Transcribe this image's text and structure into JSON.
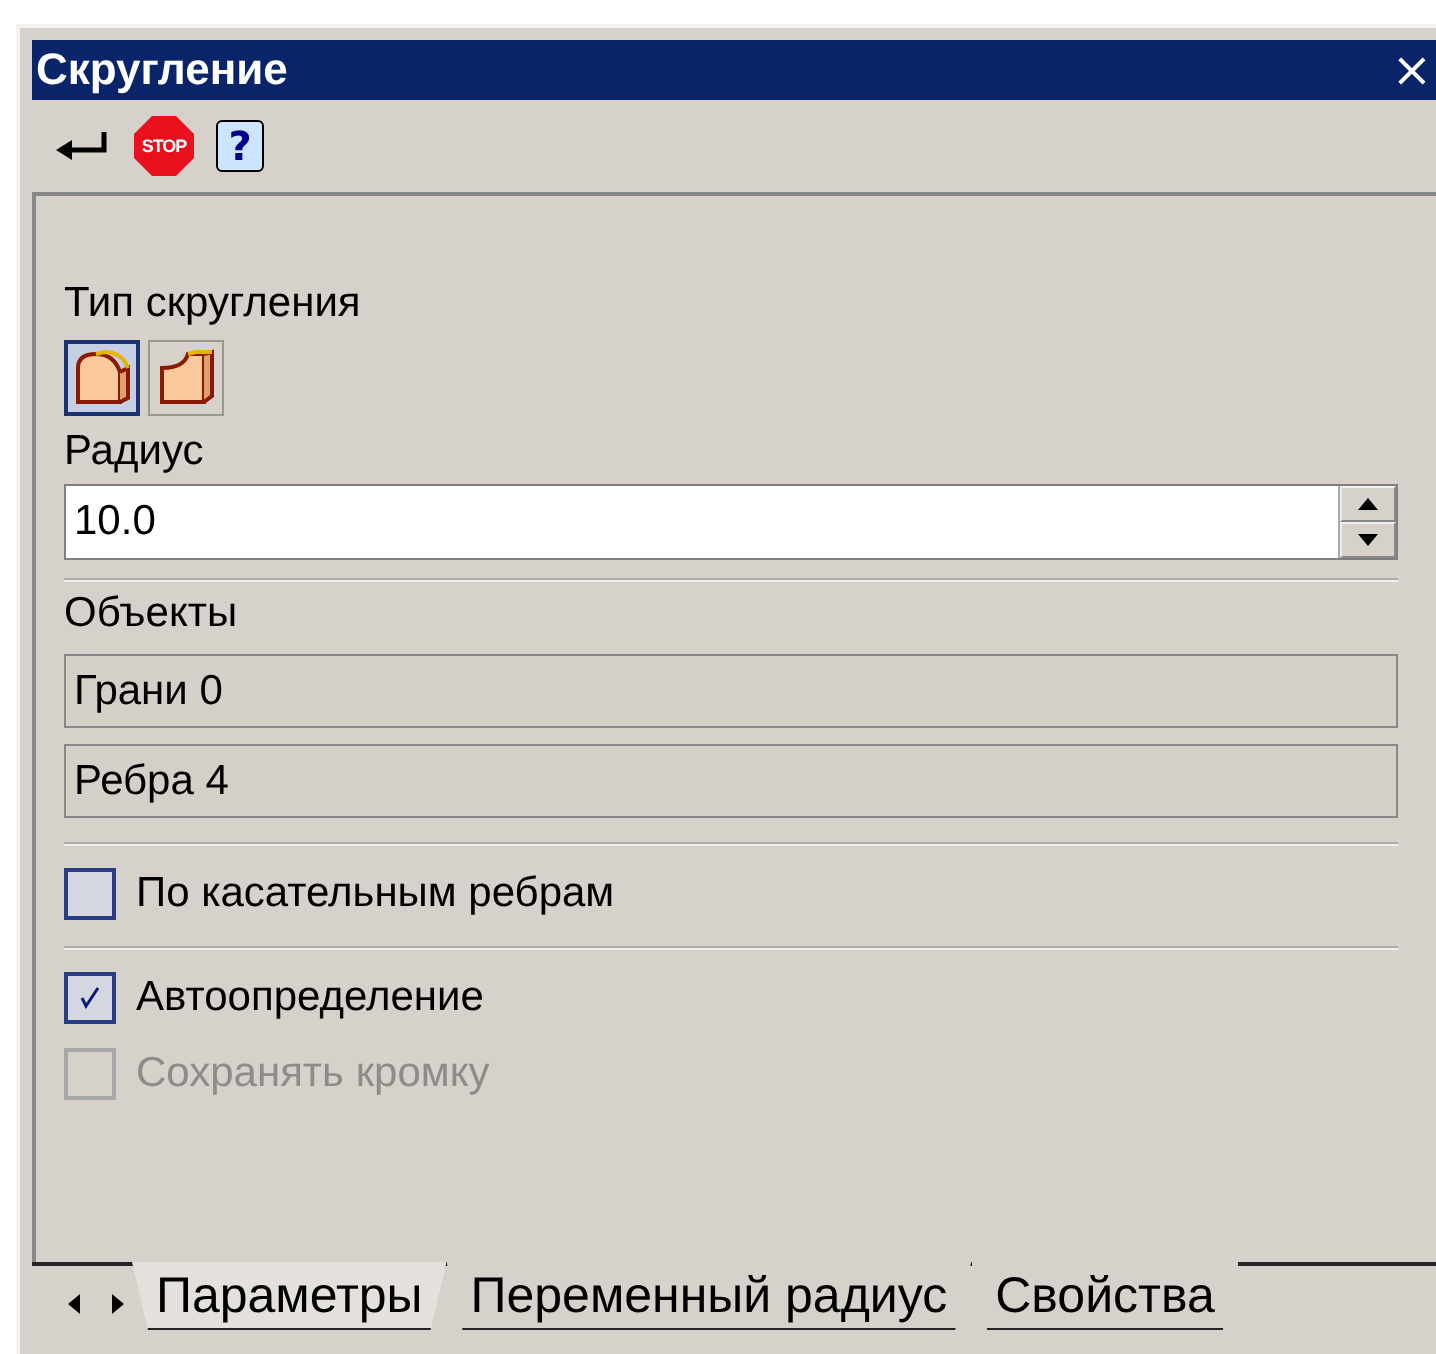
{
  "window": {
    "title": "Скругление",
    "close": "×"
  },
  "toolbar": [
    {
      "kind": "enter"
    },
    {
      "kind": "stop",
      "text": "STOP"
    },
    {
      "kind": "help",
      "text": "?"
    }
  ],
  "fillet_type": {
    "label": "Тип скругления",
    "options": [
      {
        "kind": "round",
        "selected": true
      },
      {
        "kind": "chamfer",
        "selected": false
      }
    ]
  },
  "radius": {
    "label": "Радиус",
    "value": "10.0"
  },
  "objects": {
    "label": "Объекты",
    "fields": [
      "Грани 0",
      "Ребра 4"
    ]
  },
  "checkbox_groups": [
    [
      {
        "label": "По касательным ребрам",
        "checked": false,
        "disabled": false
      }
    ],
    [
      {
        "label": "Автоопределение",
        "checked": true,
        "disabled": false
      },
      {
        "label": "Сохранять кромку",
        "checked": false,
        "disabled": true
      }
    ]
  ],
  "tabs": [
    {
      "label": "Параметры",
      "selected": true
    },
    {
      "label": "Переменный радиус",
      "selected": false
    },
    {
      "label": "Свойства",
      "selected": false
    }
  ]
}
